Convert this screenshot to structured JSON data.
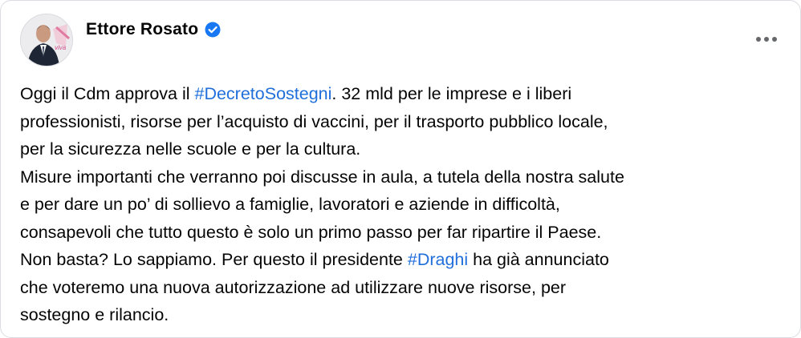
{
  "post": {
    "author": "Ettore Rosato",
    "verified_icon": "verified-badge-icon",
    "more_icon": "more-options-icon",
    "accent_color": "#216fdb",
    "avatar_text": "viva",
    "text": {
      "l1_a": "Oggi il Cdm approva il ",
      "l1_tag": "#DecretoSostegni",
      "l1_b": ". 32 mld per le imprese e i liberi",
      "l2": "professionisti, risorse per l’acquisto di vaccini, per il trasporto pubblico locale,",
      "l3": "per la sicurezza nelle scuole e per la cultura.",
      "l4": "Misure importanti che verranno poi discusse in aula, a tutela della nostra salute",
      "l5": "e per dare un po’ di sollievo a famiglie, lavoratori e aziende in difficoltà,",
      "l6": "consapevoli che tutto questo è solo un primo passo per far ripartire il Paese.",
      "l7_a": "Non basta? Lo sappiamo. Per questo il presidente ",
      "l7_tag": "#Draghi",
      "l7_b": " ha già annunciato",
      "l8": "che voteremo una nuova autorizzazione ad utilizzare nuove risorse, per",
      "l9": "sostegno e rilancio."
    }
  }
}
